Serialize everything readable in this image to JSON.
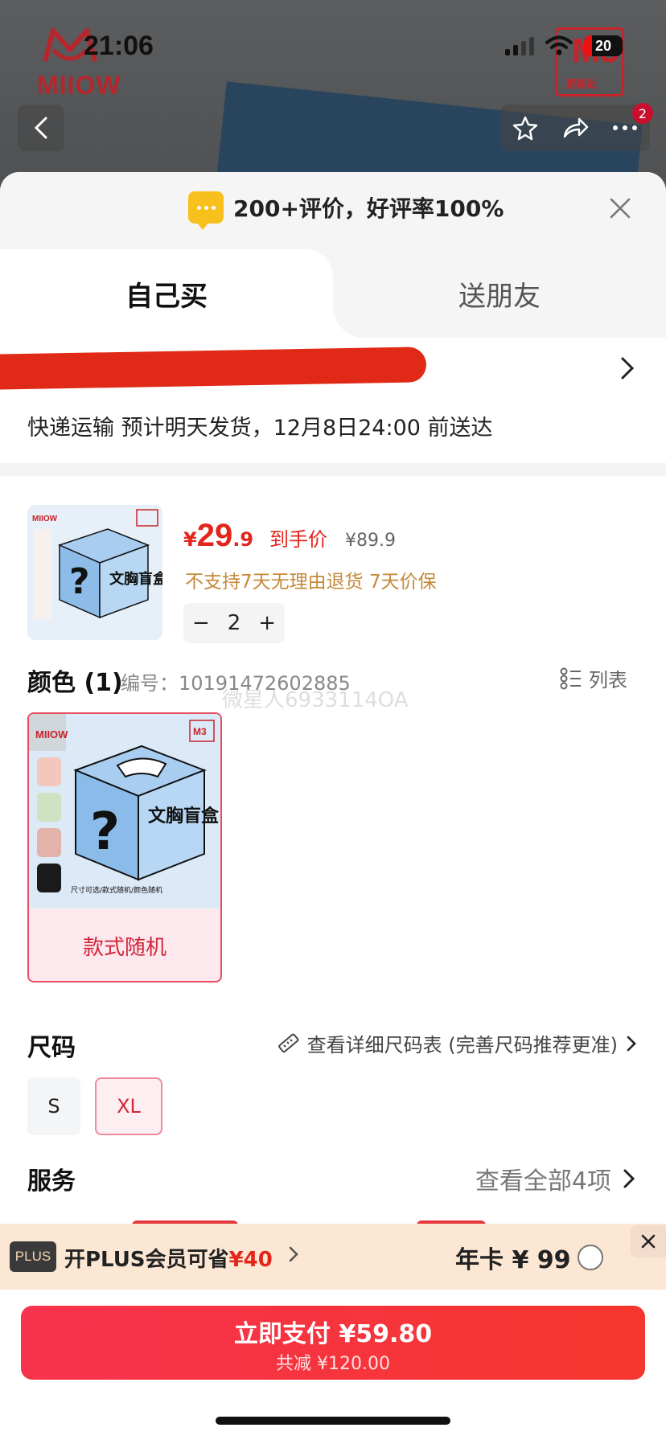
{
  "status_bar": {
    "time": "21:06",
    "battery": "20"
  },
  "brand": {
    "logo_text": "MIIOW",
    "badge_big": "M3",
    "badge_small": "更基础"
  },
  "topbar": {
    "notification_count": "2"
  },
  "sheet": {
    "review_summary": "200+评价，好评率100%",
    "tabs": {
      "buy_self": "自己买",
      "gift": "送朋友"
    },
    "delivery_text": "快递运输 预计明天发货，12月8日24:00 前送达"
  },
  "product": {
    "price_symbol": "¥",
    "price_int": "29",
    "price_dec": ".9",
    "price_label": "到手价",
    "original_price": "¥89.9",
    "policy_text": "不支持7天无理由退货  7天价保",
    "quantity": "2",
    "box_text": "文胸盲盒",
    "box_caption": "尺寸可选/款式随机/颜色随机"
  },
  "color_section": {
    "title": "颜色 (1)",
    "sku_code": "编号：10191472602885",
    "list_toggle": "列表",
    "watermark": "微星人6933114OA",
    "option_label": "款式随机"
  },
  "size_section": {
    "title": "尺码",
    "guide_link": "查看详细尺码表 (完善尺码推荐更准)",
    "options": [
      "S",
      "XL"
    ],
    "selected": "XL"
  },
  "service_section": {
    "title": "服务",
    "view_all": "查看全部4项"
  },
  "plus_bar": {
    "badge": "PLUS",
    "text_prefix": "开PLUS会员可省",
    "amount": "¥40",
    "annual": "年卡 ¥ 99"
  },
  "pay_button": {
    "main": "立即支付 ¥59.80",
    "sub": "共减 ¥120.00"
  },
  "colors": {
    "accent_red": "#e3261c",
    "plus_bg": "#fbe7d3",
    "review_yellow": "#f8c01d"
  }
}
